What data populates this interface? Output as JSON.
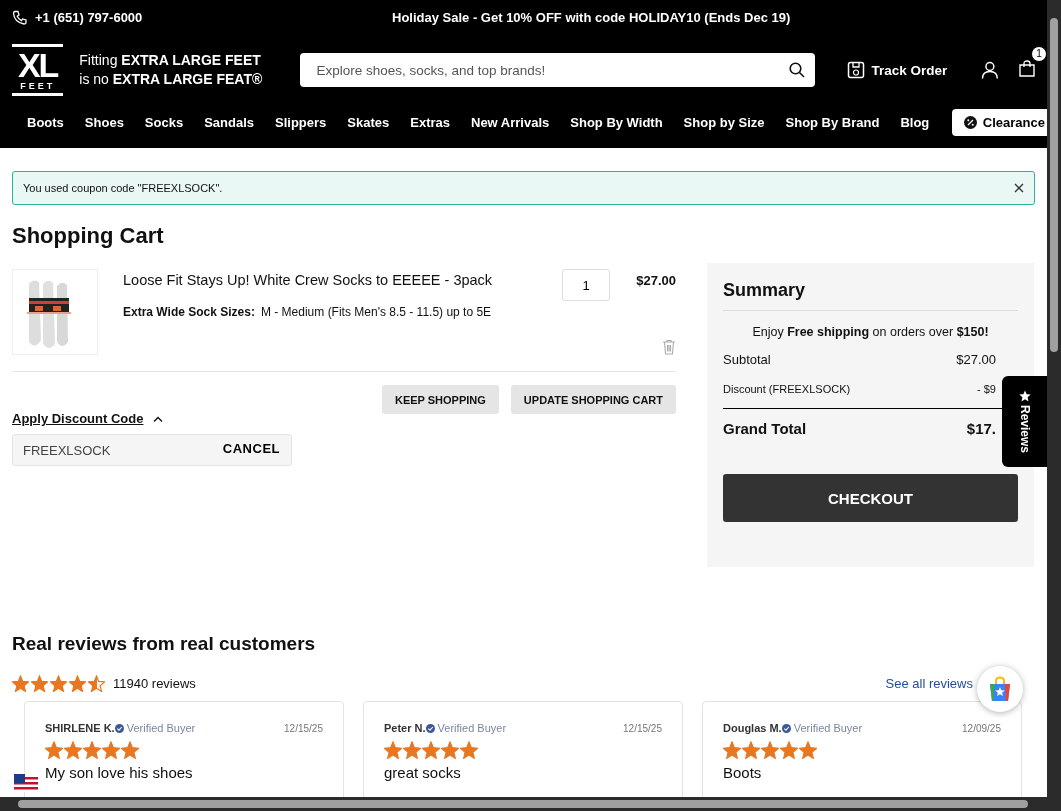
{
  "top_bar": {
    "phone": "+1 (651) 797-6000",
    "promo": "Holiday Sale - Get 10% OFF with code HOLIDAY10 (Ends Dec 19)"
  },
  "header": {
    "logo": {
      "letters": "XL",
      "sub": "FEET"
    },
    "tagline": [
      "Fitting **EXTRA LARGE FEET**",
      "is no **EXTRA LARGE FEAT®**"
    ],
    "search": {
      "placeholder": "Explore shoes, socks, and top brands!"
    },
    "track_order": "Track Order",
    "cart_count": "1"
  },
  "nav": {
    "items": [
      "Boots",
      "Shoes",
      "Socks",
      "Sandals",
      "Slippers",
      "Skates",
      "Extras",
      "New Arrivals",
      "Shop By Width",
      "Shop by Size",
      "Shop By Brand",
      "Blog"
    ],
    "clearance": "Clearance"
  },
  "alert": {
    "text": "You used coupon code \"FREEXLSOCK\"."
  },
  "cart": {
    "title": "Shopping Cart",
    "items": [
      {
        "kind": "picture",
        "name": "Loose Fit Stays Up! White Crew Socks to EEEEE - 3pack",
        "option_label": "Extra Wide Sock Sizes:",
        "option_value": "M - Medium (Fits Men's 8.5 - 11.5) up to 5E",
        "qty": "1",
        "price": "$27.00"
      }
    ],
    "buttons": [
      "KEEP SHOPPING",
      "UPDATE SHOPPING CART"
    ],
    "discount": {
      "label": "Apply Discount Code",
      "expanded": true,
      "value": "FREEXLSOCK",
      "cancel": "CANCEL"
    }
  },
  "summary": {
    "title": "Summary",
    "shipping_note": "Enjoy **Free shipping** on orders over **$150!**",
    "rows": [
      {
        "kind": "normal",
        "label": "Subtotal",
        "value": "$27.00"
      },
      {
        "kind": "small",
        "label": "Discount (FREEXLSOCK)",
        "value": "- $9"
      },
      {
        "kind": "total",
        "label": "Grand Total",
        "value": "$17."
      }
    ],
    "checkout": "CHECKOUT"
  },
  "reviews_tab": "Reviews",
  "reviews": {
    "title": "Real reviews from real customers",
    "stars": 4.5,
    "count": "11940 reviews",
    "see_all": "See all reviews",
    "cards": [
      {
        "name": "SHIRLENE K.",
        "verified": "Verified Buyer",
        "date": "12/15/25",
        "stars": 5,
        "title": "My son love his shoes"
      },
      {
        "name": "Peter N.",
        "verified": "Verified Buyer",
        "date": "12/15/25",
        "stars": 5,
        "title": "great socks"
      },
      {
        "name": "Douglas M.",
        "verified": "Verified Buyer",
        "date": "12/09/25",
        "stars": 5,
        "title": "Boots"
      }
    ]
  }
}
